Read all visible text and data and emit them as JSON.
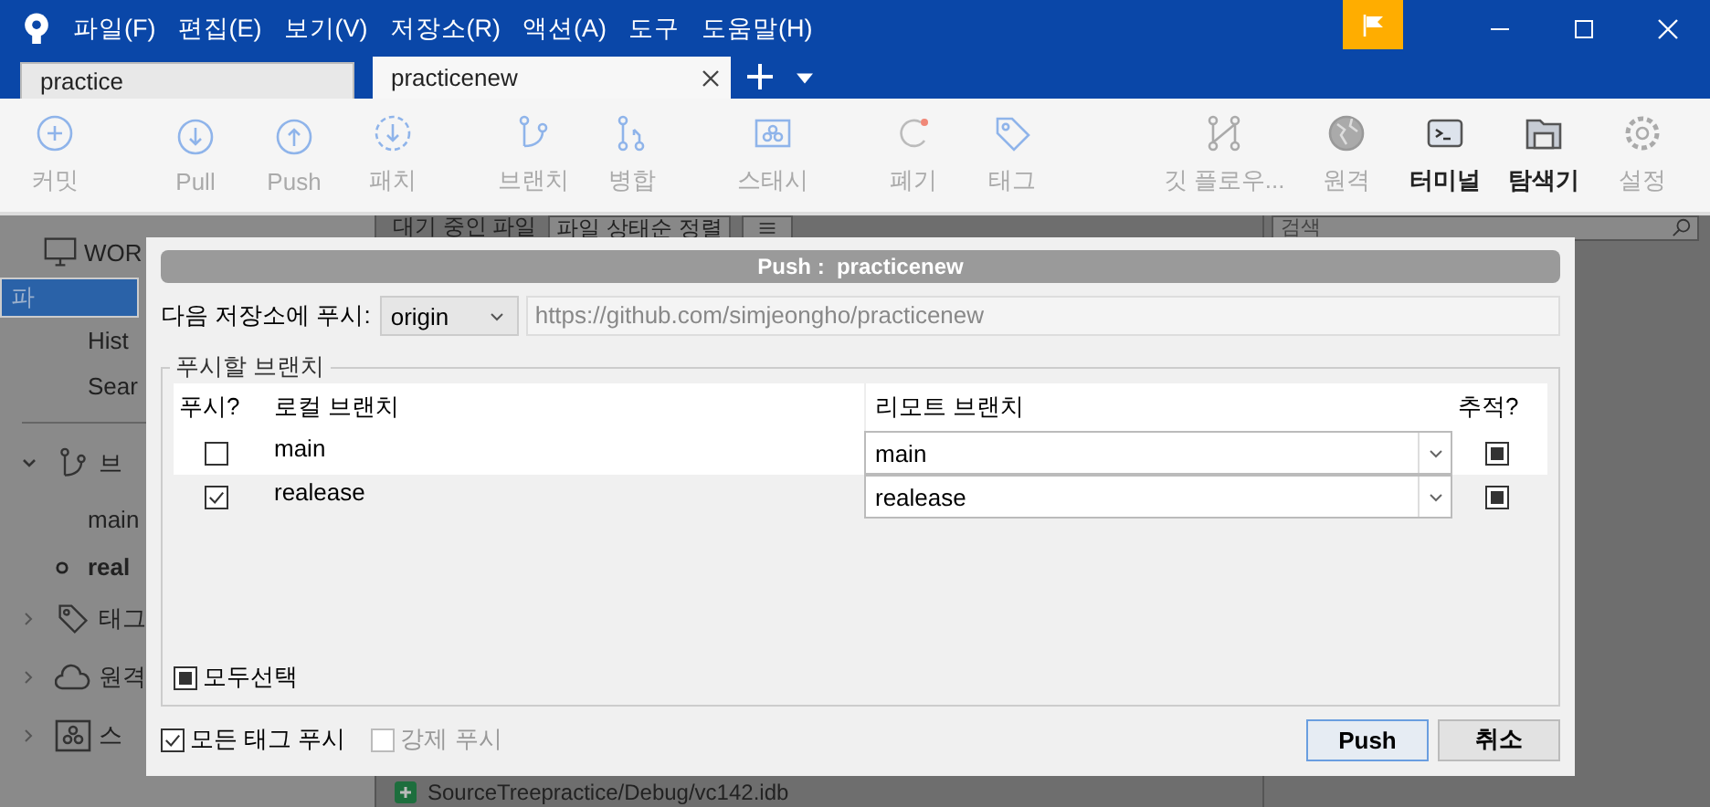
{
  "menu": [
    "파일(F)",
    "편집(E)",
    "보기(V)",
    "저장소(R)",
    "액션(A)",
    "도구",
    "도움말(H)"
  ],
  "tabs": [
    {
      "label": "practice",
      "selected": false
    },
    {
      "label": "practicenew",
      "selected": true
    }
  ],
  "toolbar": {
    "left": [
      [
        {
          "kind": "commit",
          "label": "커밋",
          "enabled": false
        }
      ],
      [
        {
          "kind": "pull",
          "label": "Pull",
          "enabled": false
        },
        {
          "kind": "push",
          "label": "Push",
          "enabled": false
        },
        {
          "kind": "fetch",
          "label": "패치",
          "enabled": false
        }
      ],
      [
        {
          "kind": "branch",
          "label": "브랜치",
          "enabled": false
        },
        {
          "kind": "merge",
          "label": "병합",
          "enabled": false
        }
      ],
      [
        {
          "kind": "stash",
          "label": "스태시",
          "enabled": false
        }
      ],
      [
        {
          "kind": "discard",
          "label": "폐기",
          "enabled": false
        },
        {
          "kind": "tag",
          "label": "태그",
          "enabled": false
        }
      ]
    ],
    "right": [
      {
        "kind": "flow",
        "label": "깃 플로우...",
        "enabled": false
      },
      {
        "kind": "remote",
        "label": "원격",
        "enabled": false
      },
      {
        "kind": "terminal",
        "label": "터미널",
        "enabled": true
      },
      {
        "kind": "explorer",
        "label": "탐색기",
        "enabled": true
      },
      {
        "kind": "settings",
        "label": "설정",
        "enabled": false
      }
    ]
  },
  "sidebar": [
    {
      "kind": "header",
      "label": "WOR",
      "selected": false
    },
    {
      "kind": "item",
      "label": "파",
      "selected": true
    },
    {
      "kind": "item",
      "label": "Hist",
      "selected": false
    },
    {
      "kind": "item",
      "label": "Sear",
      "selected": false
    },
    {
      "kind": "branches",
      "label": "브",
      "selected": false
    },
    {
      "kind": "branch",
      "label": "main",
      "selected": false
    },
    {
      "kind": "current",
      "label": "real",
      "selected": false
    },
    {
      "kind": "tags",
      "label": "태그",
      "selected": false
    },
    {
      "kind": "remotes",
      "label": "원격",
      "selected": false
    },
    {
      "kind": "stashes",
      "label": "스",
      "selected": false
    }
  ],
  "file_panel": {
    "title": "대기 중인 파일",
    "sort": "파일 상태순 정렬",
    "files": [
      "SourceTreepractice/Debug/vc142.idb"
    ]
  },
  "search": {
    "placeholder": "검색"
  },
  "dialog": {
    "title": "Push :  practicenew",
    "remote_label": "다음 저장소에 푸시:",
    "remote": "origin",
    "url": "https://github.com/simjeongho/practicenew",
    "group_label": "푸시할 브랜치",
    "columns": [
      "푸시?",
      "로컬 브랜치",
      "리모트 브랜치",
      "추적?"
    ],
    "rows": [
      {
        "push": false,
        "local": "main",
        "remote": "main",
        "track": true
      },
      {
        "push": true,
        "local": "realease",
        "remote": "realease",
        "track": true
      }
    ],
    "select_all": {
      "label": "모두선택",
      "checked": true
    },
    "options": [
      {
        "label": "모든 태그 푸시",
        "checked": true,
        "disabled": false
      },
      {
        "label": "강제 푸시",
        "checked": false,
        "disabled": true
      }
    ],
    "buttons": [
      {
        "label": "Push",
        "default": true
      },
      {
        "label": "취소",
        "default": false
      }
    ]
  }
}
